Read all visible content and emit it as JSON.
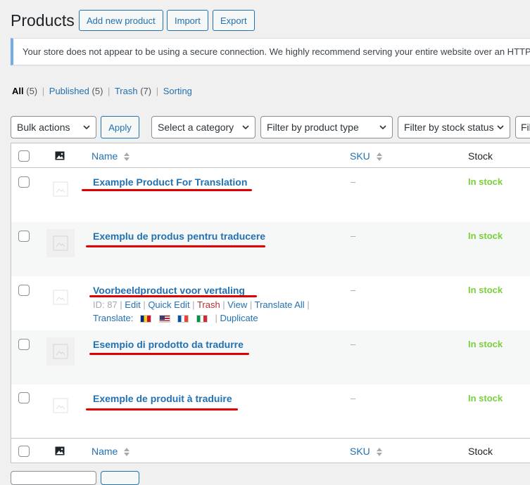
{
  "header": {
    "title": "Products",
    "add_new": "Add new product",
    "import": "Import",
    "export": "Export"
  },
  "notice": {
    "text": "Your store does not appear to be using a secure connection. We highly recommend serving your entire website over an HTTPS"
  },
  "views": [
    {
      "label": "All",
      "count": "(5)"
    },
    {
      "label": "Published",
      "count": "(5)"
    },
    {
      "label": "Trash",
      "count": "(7)"
    },
    {
      "label": "Sorting",
      "count": ""
    }
  ],
  "filters": {
    "bulk_actions": "Bulk actions",
    "apply": "Apply",
    "category": "Select a category",
    "product_type": "Filter by product type",
    "stock_status": "Filter by stock status",
    "cut_off": "Fil"
  },
  "table": {
    "columns": {
      "name": "Name",
      "sku": "SKU",
      "stock": "Stock"
    },
    "rows": [
      {
        "name": "Example Product For Translation",
        "sku": "–",
        "stock": "In stock"
      },
      {
        "name": "Exemplu de produs pentru traducere",
        "sku": "–",
        "stock": "In stock"
      },
      {
        "name": "Voorbeeldproduct voor vertaling",
        "sku": "–",
        "stock": "In stock"
      },
      {
        "name": "Esempio di prodotto da tradurre",
        "sku": "–",
        "stock": "In stock"
      },
      {
        "name": "Exemple de produit à traduire",
        "sku": "–",
        "stock": "In stock"
      }
    ],
    "row_actions": {
      "id": "ID: 87",
      "edit": "Edit",
      "quick_edit": "Quick Edit",
      "trash": "Trash",
      "view": "View",
      "translate_all": "Translate All",
      "translate": "Translate:",
      "duplicate": "Duplicate",
      "flags": [
        "romania-flag-icon",
        "usa-flag-icon",
        "france-flag-icon",
        "italy-flag-icon"
      ]
    }
  },
  "colors": {
    "accent": "#2271b1",
    "in_stock": "#7ad03a",
    "trash": "#b32d2e",
    "annotation_underline": "#e00000",
    "notice_border": "#72aee6"
  }
}
